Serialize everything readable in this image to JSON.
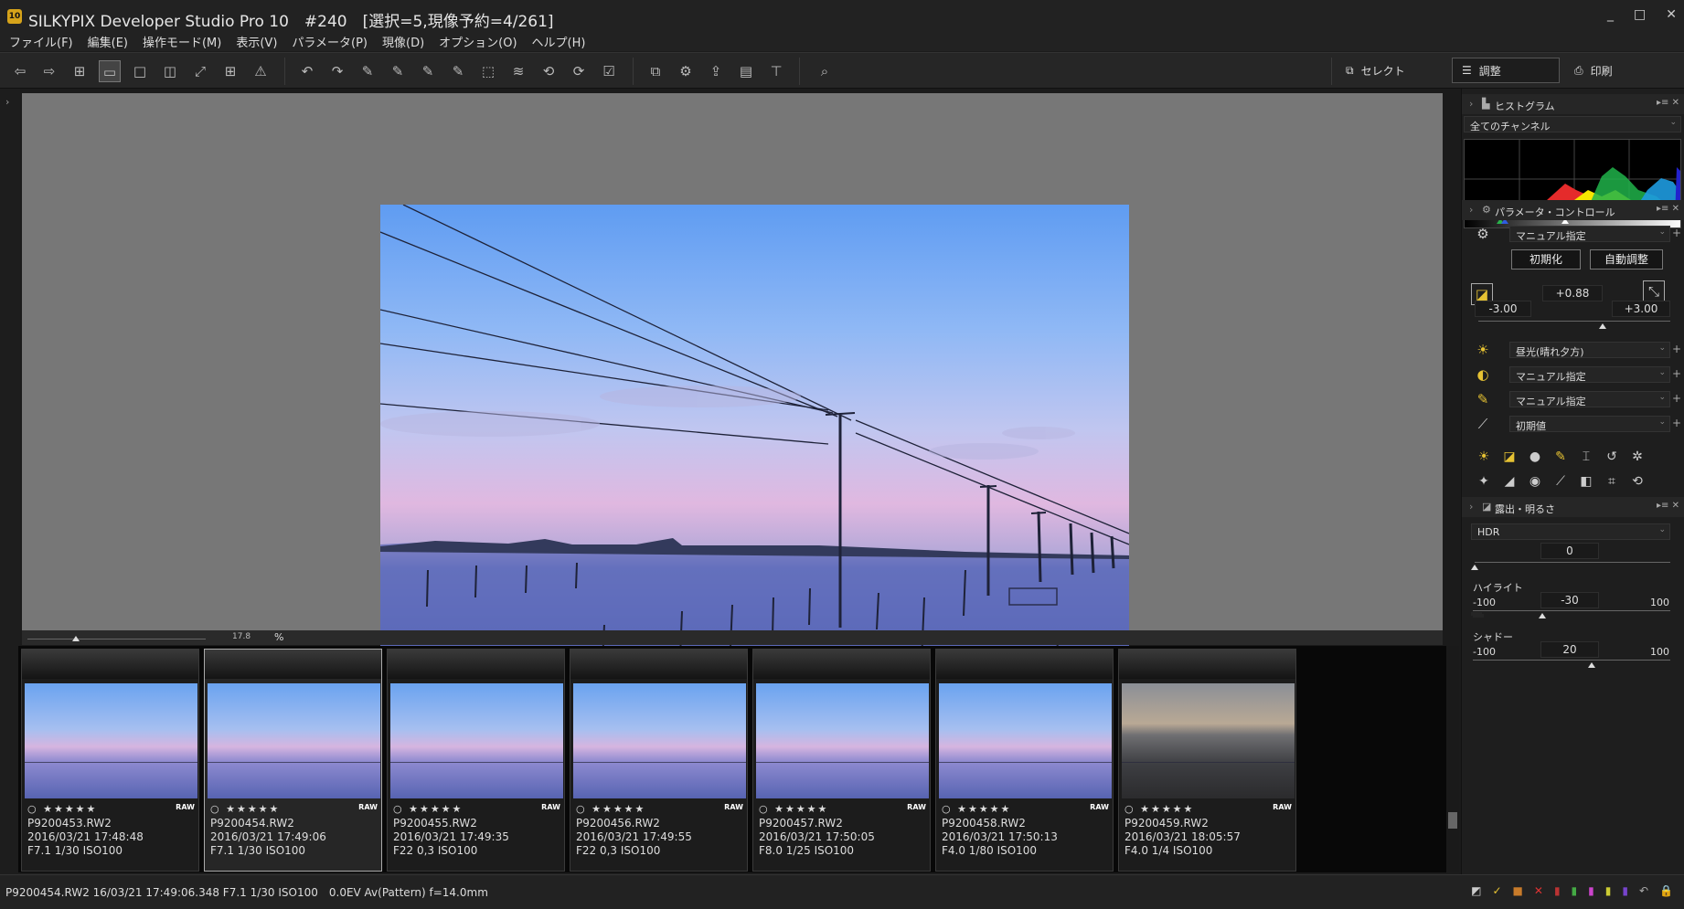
{
  "window": {
    "app_icon_text": "10",
    "title": "SILKYPIX Developer Studio Pro 10　#240　[選択=5,現像予約=4/261]",
    "controls": [
      "_",
      "□",
      "✕"
    ]
  },
  "menu": [
    "ファイル(F)",
    "編集(E)",
    "操作モード(M)",
    "表示(V)",
    "パラメータ(P)",
    "現像(D)",
    "オプション(O)",
    "ヘルプ(H)"
  ],
  "modes": {
    "select_label": "セレクト",
    "adjust_label": "調整",
    "print_label": "印刷"
  },
  "zoom": {
    "value": "17.8",
    "unit": "%",
    "level": 0.17
  },
  "thumbnails": [
    {
      "name": "P9200453.RW2",
      "date": "2016/03/21 17:48:48",
      "exif": "F7.1 1/30 ISO100",
      "stars": "○ ★★★★★",
      "raw": "RAW",
      "kind": "sky"
    },
    {
      "name": "P9200454.RW2",
      "date": "2016/03/21 17:49:06",
      "exif": "F7.1 1/30 ISO100",
      "stars": "○ ★★★★★",
      "raw": "RAW",
      "kind": "sky"
    },
    {
      "name": "P9200455.RW2",
      "date": "2016/03/21 17:49:35",
      "exif": "F22 0,3 ISO100",
      "stars": "○ ★★★★★",
      "raw": "RAW",
      "kind": "sky"
    },
    {
      "name": "P9200456.RW2",
      "date": "2016/03/21 17:49:55",
      "exif": "F22 0,3 ISO100",
      "stars": "○ ★★★★★",
      "raw": "RAW",
      "kind": "sky"
    },
    {
      "name": "P9200457.RW2",
      "date": "2016/03/21 17:50:05",
      "exif": "F8.0 1/25 ISO100",
      "stars": "○ ★★★★★",
      "raw": "RAW",
      "kind": "sky"
    },
    {
      "name": "P9200458.RW2",
      "date": "2016/03/21 17:50:13",
      "exif": "F4.0 1/80 ISO100",
      "stars": "○ ★★★★★",
      "raw": "RAW",
      "kind": "sky"
    },
    {
      "name": "P9200459.RW2",
      "date": "2016/03/21 18:05:57",
      "exif": "F4.0 1/4 ISO100",
      "stars": "○ ★★★★★",
      "raw": "RAW",
      "kind": "beach"
    }
  ],
  "histogram_panel": {
    "title": "ヒストグラム",
    "channel": "全てのチャンネル"
  },
  "param_panel": {
    "title": "パラメータ・コントロール",
    "preset": "マニュアル指定",
    "reset_button": "初期化",
    "auto_button": "自動調整",
    "exposure_value": "+0.88",
    "exposure_min": "-3.00",
    "exposure_max": "+3.00",
    "wb": "昼光(晴れ夕方)",
    "tone": "マニュアル指定",
    "sharpness": "マニュアル指定",
    "noise": "初期値"
  },
  "exposure_panel": {
    "title": "露出・明るさ",
    "hdr_label": "HDR",
    "hdr_value": "0",
    "highlight_label": "ハイライト",
    "highlight_min": "-100",
    "highlight_value": "-30",
    "highlight_max": "100",
    "shadow_label": "シャドー",
    "shadow_min": "-100",
    "shadow_value": "20",
    "shadow_max": "100"
  },
  "status": {
    "text": "P9200454.RW2 16/03/21 17:49:06.348 F7.1 1/30 ISO100　0.0EV Av(Pattern) f=14.0mm"
  },
  "colors": {
    "background": "#1b1b1b",
    "accent": "#e6c233",
    "selection_border": "#aaaaaa"
  }
}
